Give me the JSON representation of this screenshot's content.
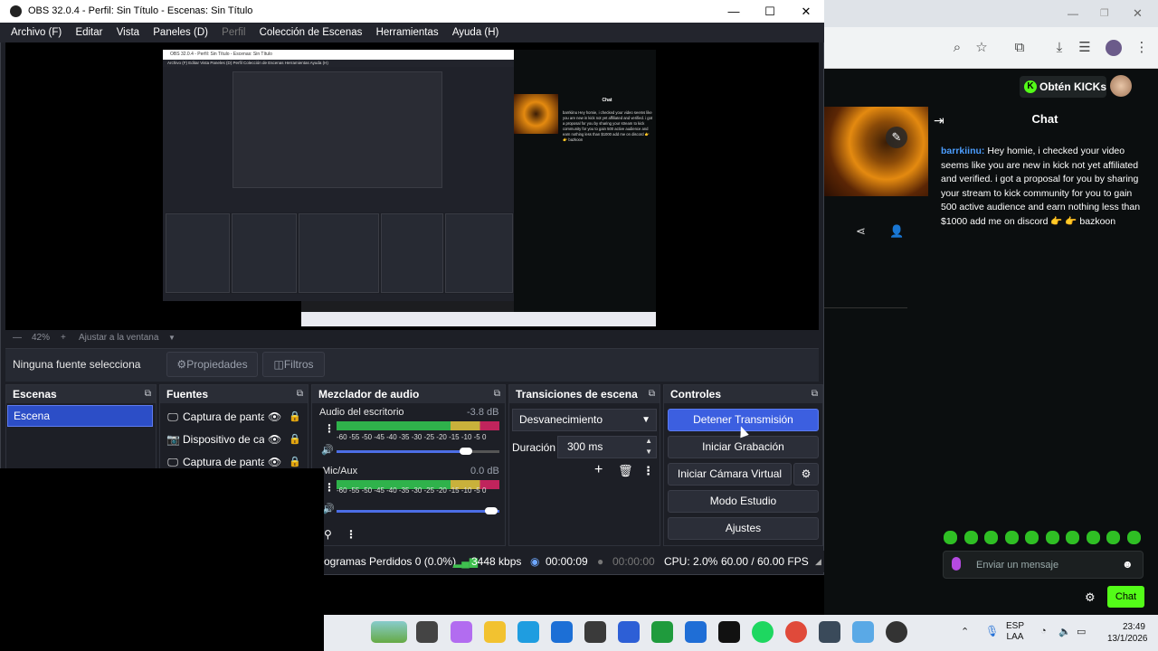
{
  "obs": {
    "title": "OBS 32.0.4 - Perfil: Sin Título - Escenas: Sin Título",
    "window_controls": {
      "minimize": "—",
      "maximize": "☐",
      "close": "✕"
    },
    "menu": [
      "Archivo (F)",
      "Editar",
      "Vista",
      "Paneles (D)",
      "Perfil",
      "Colección de Escenas",
      "Herramientas",
      "Ayuda (H)"
    ],
    "zoom": {
      "minus": "—",
      "value": "42%",
      "plus": "+",
      "fit": "Ajustar a la ventana",
      "dropdown": "▼"
    },
    "source_toolbar": {
      "none_selected": "Ninguna fuente selecciona",
      "properties": "Propiedades",
      "filters": "Filtros"
    },
    "docks": {
      "scenes": {
        "title": "Escenas",
        "items": [
          "Escena"
        ]
      },
      "sources": {
        "title": "Fuentes",
        "items": [
          {
            "icon": "monitor-icon",
            "glyph": "🖵",
            "label": "Captura de pantalla"
          },
          {
            "icon": "camera-icon",
            "glyph": "📷",
            "label": "Dispositivo de captura"
          },
          {
            "icon": "monitor-icon",
            "glyph": "🖵",
            "label": "Captura de pantalla"
          }
        ]
      },
      "mixer": {
        "title": "Mezclador de audio",
        "scale": "-60 -55 -50 -45 -40 -35 -30 -25 -20 -15 -10  -5   0",
        "channels": [
          {
            "name": "Audio del escritorio",
            "db": "-3.8 dB",
            "volume": 0.9
          },
          {
            "name": "Mic/Aux",
            "db": "0.0 dB",
            "volume": 1.0
          }
        ]
      },
      "transitions": {
        "title": "Transiciones de escena",
        "selected": "Desvanecimiento",
        "duration_label": "Duración",
        "duration_value": "300 ms"
      },
      "controls": {
        "title": "Controles",
        "stop_stream": "Detener Transmisión",
        "start_record": "Iniciar Grabación",
        "start_vcam": "Iniciar Cámara Virtual",
        "studio_mode": "Modo Estudio",
        "settings": "Ajustes"
      }
    },
    "status": {
      "dropped": "ogramas Perdidos 0 (0.0%)",
      "bitrate": "3448 kbps",
      "stream_time": "00:00:09",
      "record_time": "00:00:00",
      "cpu": "CPU: 2.0%",
      "fps": "60.00 / 60.00 FPS"
    },
    "colors": {
      "accent": "#3c5fe0",
      "bg": "#1d1f26",
      "panel_head": "#2a2d36"
    }
  },
  "preview": {
    "title": "OBS 32.0.4 - Perfil: Sin Título - Escenas: Sin Título",
    "menu": "Archivo (F)   Editar   Vista   Paneles (D)   Perfil   Colección de Escenas   Herramientas   Ayuda (H)",
    "chat_title": "Chat",
    "chat_text": "barrkiinu Hey homie, i checked your video seems like you are new in kick not yet affiliated and verified. i got a proposal for you by sharing your stream to kick community for you to gain 500 active audience and earn nothing less than $1000 add me on discord 👉 👉 bazkoon"
  },
  "kick": {
    "get_kicks": "Obtén KICKs",
    "chat_title": "Chat",
    "message": {
      "user": "barrkiinu:",
      "text": " Hey homie, i checked your video seems like you are new in kick not yet affiliated and verified. i got a proposal for you by sharing your stream to kick community for you to gain 500 active audience and earn nothing less than $1000 add me on discord 👉 👉 bazkoon"
    },
    "input_placeholder": "Enviar un mensaje",
    "send": "Chat"
  },
  "taskbar": {
    "language": "ESP\nLAA",
    "lang_line1": "ESP",
    "lang_line2": "LAA",
    "time": "23:49",
    "date": "13/1/2026"
  }
}
